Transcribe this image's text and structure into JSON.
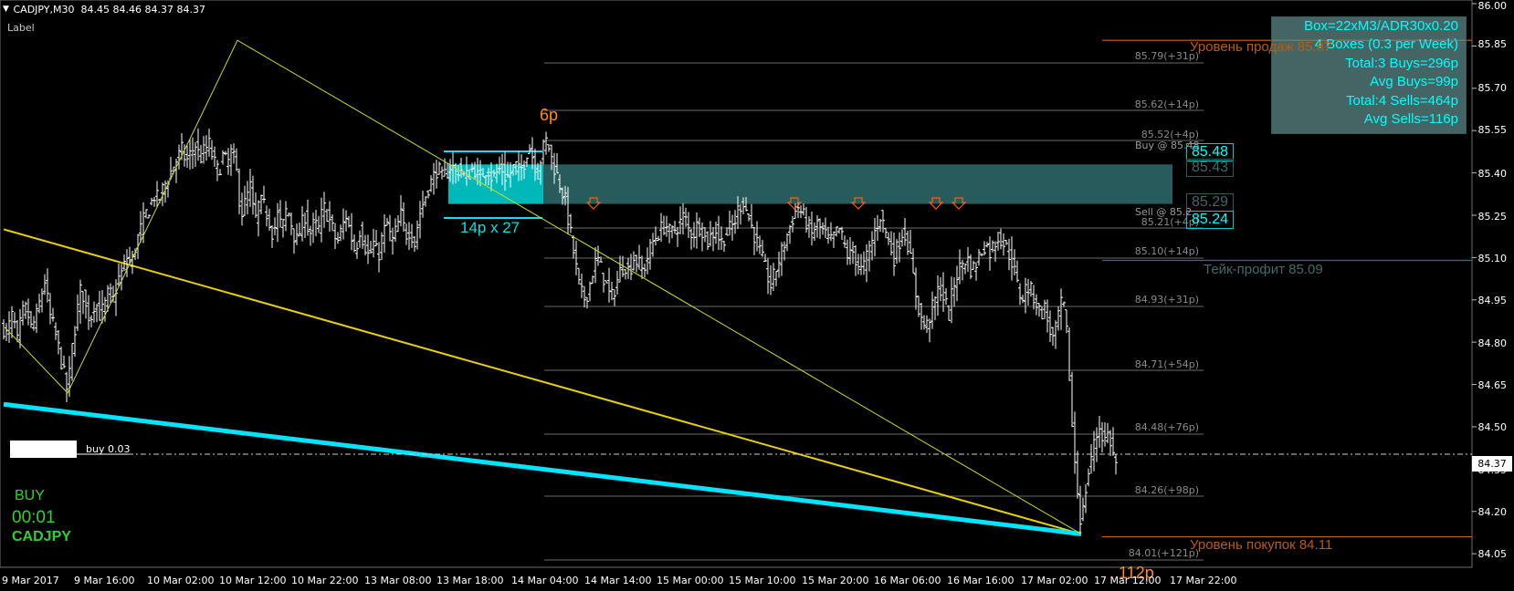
{
  "header": {
    "symbol_tf": "CADJPY,M30",
    "ohlc": "84.45 84.46 84.37 84.37",
    "label": "Label",
    "dropdown_glyph": "▼"
  },
  "price_axis": [
    "86.00",
    "85.85",
    "85.70",
    "85.55",
    "85.40",
    "85.25",
    "85.10",
    "84.95",
    "84.80",
    "84.65",
    "84.50",
    "84.35",
    "84.20",
    "84.05"
  ],
  "current_price": "84.37",
  "time_axis": [
    "9 Mar 2017",
    "9 Mar 16:00",
    "10 Mar 02:00",
    "10 Mar 12:00",
    "10 Mar 22:00",
    "13 Mar 08:00",
    "13 Mar 18:00",
    "14 Mar 04:00",
    "14 Mar 14:00",
    "15 Mar 00:00",
    "15 Mar 10:00",
    "15 Mar 20:00",
    "16 Mar 06:00",
    "16 Mar 16:00",
    "17 Mar 02:00",
    "17 Mar 12:00",
    "17 Mar 22:00"
  ],
  "stats_panel": [
    "Box=22xM3/ADR30x0.20",
    "4 Boxes (0.3 per Week)",
    "Total:3 Buys=296p",
    "Avg Buys=99p",
    "Total:4 Sells=464p",
    "Avg Sells=116p"
  ],
  "levels": {
    "sell": "Уровень продаж 85.87",
    "buy": "Уровень покупок 84.11",
    "take_profit": "Тейк-профит 85.09"
  },
  "fib_labels": [
    "85.79(+31p)",
    "85.62(+14p)",
    "85.52(+4p)",
    "85.21(+4p)",
    "85.10(+14p)",
    "84.93(+31p)",
    "84.71(+54p)",
    "84.48(+76p)",
    "84.26(+98p)",
    "84.01(+121p)"
  ],
  "order_boxes": [
    "85.48",
    "85.43",
    "85.29",
    "85.24"
  ],
  "order_texts": {
    "buy": "Buy @ 85.48",
    "sell": "Sell @ 85.2"
  },
  "box_caption": "14p x 27",
  "top_pips": "6p",
  "low_pips": "112p",
  "buy_order": "buy 0.03",
  "signal": {
    "label": "BUY",
    "timer": "00:01",
    "symbol": "CADJPY"
  },
  "colors": {
    "bull_candle": "#ffffff",
    "zigzag": "#c0e020",
    "trend_yellow": "#e6d200",
    "trend_cyan": "#00e5ff",
    "box_fill": "#00cccc",
    "zone_fill": "#2f6b6b",
    "sell_arrow": "#ff5a1e"
  },
  "chart_data": {
    "type": "candlestick",
    "symbol": "CADJPY",
    "timeframe": "M30",
    "ylim": [
      84.0,
      86.0
    ],
    "close_path": [
      [
        0,
        84.85
      ],
      [
        4,
        84.82
      ],
      [
        8,
        84.9
      ],
      [
        12,
        84.86
      ],
      [
        15,
        84.8
      ],
      [
        20,
        84.9
      ],
      [
        25,
        84.92
      ],
      [
        30,
        84.85
      ],
      [
        35,
        84.88
      ],
      [
        40,
        84.95
      ],
      [
        45,
        85.02
      ],
      [
        50,
        84.9
      ],
      [
        55,
        84.85
      ],
      [
        60,
        84.78
      ],
      [
        65,
        84.7
      ],
      [
        70,
        84.62
      ],
      [
        75,
        84.78
      ],
      [
        80,
        84.9
      ],
      [
        85,
        85.0
      ],
      [
        90,
        84.92
      ],
      [
        95,
        84.88
      ],
      [
        100,
        84.95
      ],
      [
        105,
        84.9
      ],
      [
        110,
        84.92
      ],
      [
        115,
        84.98
      ],
      [
        120,
        84.95
      ],
      [
        125,
        85.02
      ],
      [
        130,
        85.05
      ],
      [
        135,
        85.1
      ],
      [
        140,
        85.08
      ],
      [
        145,
        85.15
      ],
      [
        150,
        85.2
      ],
      [
        155,
        85.25
      ],
      [
        160,
        85.28
      ],
      [
        165,
        85.32
      ],
      [
        170,
        85.3
      ],
      [
        175,
        85.35
      ],
      [
        180,
        85.38
      ],
      [
        185,
        85.42
      ],
      [
        190,
        85.45
      ],
      [
        195,
        85.48
      ],
      [
        200,
        85.44
      ],
      [
        205,
        85.47
      ],
      [
        210,
        85.5
      ],
      [
        215,
        85.45
      ],
      [
        220,
        85.48
      ],
      [
        225,
        85.5
      ],
      [
        230,
        85.44
      ],
      [
        235,
        85.4
      ],
      [
        240,
        85.46
      ],
      [
        245,
        85.43
      ],
      [
        250,
        85.48
      ],
      [
        255,
        85.4
      ],
      [
        260,
        85.25
      ],
      [
        265,
        85.3
      ],
      [
        270,
        85.35
      ],
      [
        275,
        85.22
      ],
      [
        280,
        85.3
      ],
      [
        285,
        85.28
      ],
      [
        290,
        85.24
      ],
      [
        295,
        85.18
      ],
      [
        300,
        85.25
      ],
      [
        305,
        85.2
      ],
      [
        310,
        85.28
      ],
      [
        315,
        85.22
      ],
      [
        320,
        85.15
      ],
      [
        325,
        85.2
      ],
      [
        330,
        85.25
      ],
      [
        335,
        85.18
      ],
      [
        340,
        85.22
      ],
      [
        345,
        85.2
      ],
      [
        350,
        85.28
      ],
      [
        355,
        85.25
      ],
      [
        360,
        85.2
      ],
      [
        365,
        85.15
      ],
      [
        370,
        85.2
      ],
      [
        375,
        85.25
      ],
      [
        380,
        85.18
      ],
      [
        385,
        85.12
      ],
      [
        390,
        85.2
      ],
      [
        395,
        85.15
      ],
      [
        400,
        85.1
      ],
      [
        405,
        85.15
      ],
      [
        410,
        85.1
      ],
      [
        415,
        85.18
      ],
      [
        420,
        85.22
      ],
      [
        425,
        85.15
      ],
      [
        430,
        85.2
      ],
      [
        435,
        85.25
      ],
      [
        440,
        85.18
      ],
      [
        445,
        85.2
      ],
      [
        450,
        85.15
      ],
      [
        455,
        85.25
      ],
      [
        460,
        85.3
      ],
      [
        465,
        85.35
      ],
      [
        470,
        85.38
      ],
      [
        475,
        85.42
      ],
      [
        480,
        85.38
      ],
      [
        485,
        85.4
      ],
      [
        490,
        85.43
      ],
      [
        495,
        85.4
      ],
      [
        500,
        85.42
      ],
      [
        505,
        85.38
      ],
      [
        510,
        85.4
      ],
      [
        515,
        85.42
      ],
      [
        520,
        85.38
      ],
      [
        525,
        85.4
      ],
      [
        530,
        85.42
      ],
      [
        535,
        85.38
      ],
      [
        540,
        85.4
      ],
      [
        545,
        85.42
      ],
      [
        550,
        85.38
      ],
      [
        555,
        85.4
      ],
      [
        560,
        85.43
      ],
      [
        565,
        85.4
      ],
      [
        570,
        85.44
      ],
      [
        575,
        85.5
      ],
      [
        580,
        85.45
      ],
      [
        585,
        85.4
      ],
      [
        590,
        85.48
      ],
      [
        595,
        85.52
      ],
      [
        600,
        85.45
      ],
      [
        605,
        85.4
      ],
      [
        610,
        85.35
      ],
      [
        615,
        85.3
      ],
      [
        620,
        85.2
      ],
      [
        625,
        85.1
      ],
      [
        630,
        85.0
      ],
      [
        635,
        84.95
      ],
      [
        640,
        84.98
      ],
      [
        645,
        85.05
      ],
      [
        650,
        85.1
      ],
      [
        655,
        85.05
      ],
      [
        660,
        85.0
      ],
      [
        665,
        84.95
      ],
      [
        670,
        85.0
      ],
      [
        675,
        85.05
      ],
      [
        680,
        85.08
      ],
      [
        685,
        85.05
      ],
      [
        690,
        85.1
      ],
      [
        695,
        85.08
      ],
      [
        700,
        85.05
      ],
      [
        705,
        85.1
      ],
      [
        710,
        85.15
      ],
      [
        715,
        85.18
      ],
      [
        720,
        85.2
      ],
      [
        725,
        85.22
      ],
      [
        730,
        85.18
      ],
      [
        735,
        85.2
      ],
      [
        740,
        85.22
      ],
      [
        745,
        85.25
      ],
      [
        750,
        85.2
      ],
      [
        755,
        85.18
      ],
      [
        760,
        85.22
      ],
      [
        765,
        85.2
      ],
      [
        770,
        85.15
      ],
      [
        775,
        85.18
      ],
      [
        780,
        85.2
      ],
      [
        785,
        85.15
      ],
      [
        790,
        85.18
      ],
      [
        795,
        85.2
      ],
      [
        800,
        85.22
      ],
      [
        805,
        85.28
      ],
      [
        810,
        85.3
      ],
      [
        815,
        85.25
      ],
      [
        820,
        85.2
      ],
      [
        825,
        85.15
      ],
      [
        830,
        85.1
      ],
      [
        835,
        85.05
      ],
      [
        840,
        85.0
      ],
      [
        845,
        85.05
      ],
      [
        850,
        85.1
      ],
      [
        855,
        85.15
      ],
      [
        860,
        85.2
      ],
      [
        865,
        85.25
      ],
      [
        870,
        85.28
      ],
      [
        875,
        85.25
      ],
      [
        880,
        85.22
      ],
      [
        885,
        85.18
      ],
      [
        890,
        85.22
      ],
      [
        895,
        85.2
      ],
      [
        900,
        85.18
      ],
      [
        905,
        85.15
      ],
      [
        910,
        85.18
      ],
      [
        915,
        85.2
      ],
      [
        920,
        85.15
      ],
      [
        925,
        85.1
      ],
      [
        930,
        85.12
      ],
      [
        935,
        85.08
      ],
      [
        940,
        85.05
      ],
      [
        945,
        85.1
      ],
      [
        950,
        85.15
      ],
      [
        955,
        85.2
      ],
      [
        960,
        85.25
      ],
      [
        965,
        85.2
      ],
      [
        970,
        85.15
      ],
      [
        975,
        85.1
      ],
      [
        980,
        85.15
      ],
      [
        985,
        85.2
      ],
      [
        990,
        85.15
      ],
      [
        995,
        85.05
      ],
      [
        1000,
        84.95
      ],
      [
        1005,
        84.88
      ],
      [
        1010,
        84.85
      ],
      [
        1015,
        84.9
      ],
      [
        1020,
        84.95
      ],
      [
        1025,
        85.0
      ],
      [
        1030,
        84.95
      ],
      [
        1035,
        84.9
      ],
      [
        1040,
        85.0
      ],
      [
        1045,
        85.05
      ],
      [
        1050,
        85.08
      ],
      [
        1055,
        85.1
      ],
      [
        1060,
        85.05
      ],
      [
        1065,
        85.08
      ],
      [
        1070,
        85.12
      ],
      [
        1075,
        85.15
      ],
      [
        1080,
        85.12
      ],
      [
        1085,
        85.15
      ],
      [
        1090,
        85.18
      ],
      [
        1095,
        85.15
      ],
      [
        1100,
        85.12
      ],
      [
        1105,
        85.08
      ],
      [
        1110,
        85.0
      ],
      [
        1115,
        84.95
      ],
      [
        1120,
        85.0
      ],
      [
        1125,
        84.98
      ],
      [
        1130,
        84.95
      ],
      [
        1135,
        84.9
      ],
      [
        1140,
        84.92
      ],
      [
        1145,
        84.85
      ],
      [
        1150,
        84.8
      ],
      [
        1155,
        84.9
      ],
      [
        1160,
        84.95
      ],
      [
        1165,
        84.8
      ],
      [
        1170,
        84.5
      ],
      [
        1175,
        84.3
      ],
      [
        1180,
        84.15
      ],
      [
        1185,
        84.28
      ],
      [
        1190,
        84.38
      ],
      [
        1195,
        84.45
      ],
      [
        1200,
        84.5
      ],
      [
        1205,
        84.45
      ],
      [
        1210,
        84.48
      ],
      [
        1215,
        84.4
      ],
      [
        1218,
        84.37
      ]
    ],
    "zigzag": [
      [
        2,
        84.85
      ],
      [
        70,
        84.62
      ],
      [
        256,
        85.87
      ],
      [
        1180,
        84.12
      ]
    ],
    "trendlines": [
      {
        "color": "yellow",
        "from": [
          0,
          85.2
        ],
        "to": [
          1180,
          84.12
        ]
      },
      {
        "color": "cyan",
        "from": [
          0,
          84.58
        ],
        "to": [
          1180,
          84.12
        ]
      }
    ],
    "box_zone": [
      85.29,
      85.43
    ],
    "levels": [
      85.87,
      85.09,
      84.11
    ]
  }
}
